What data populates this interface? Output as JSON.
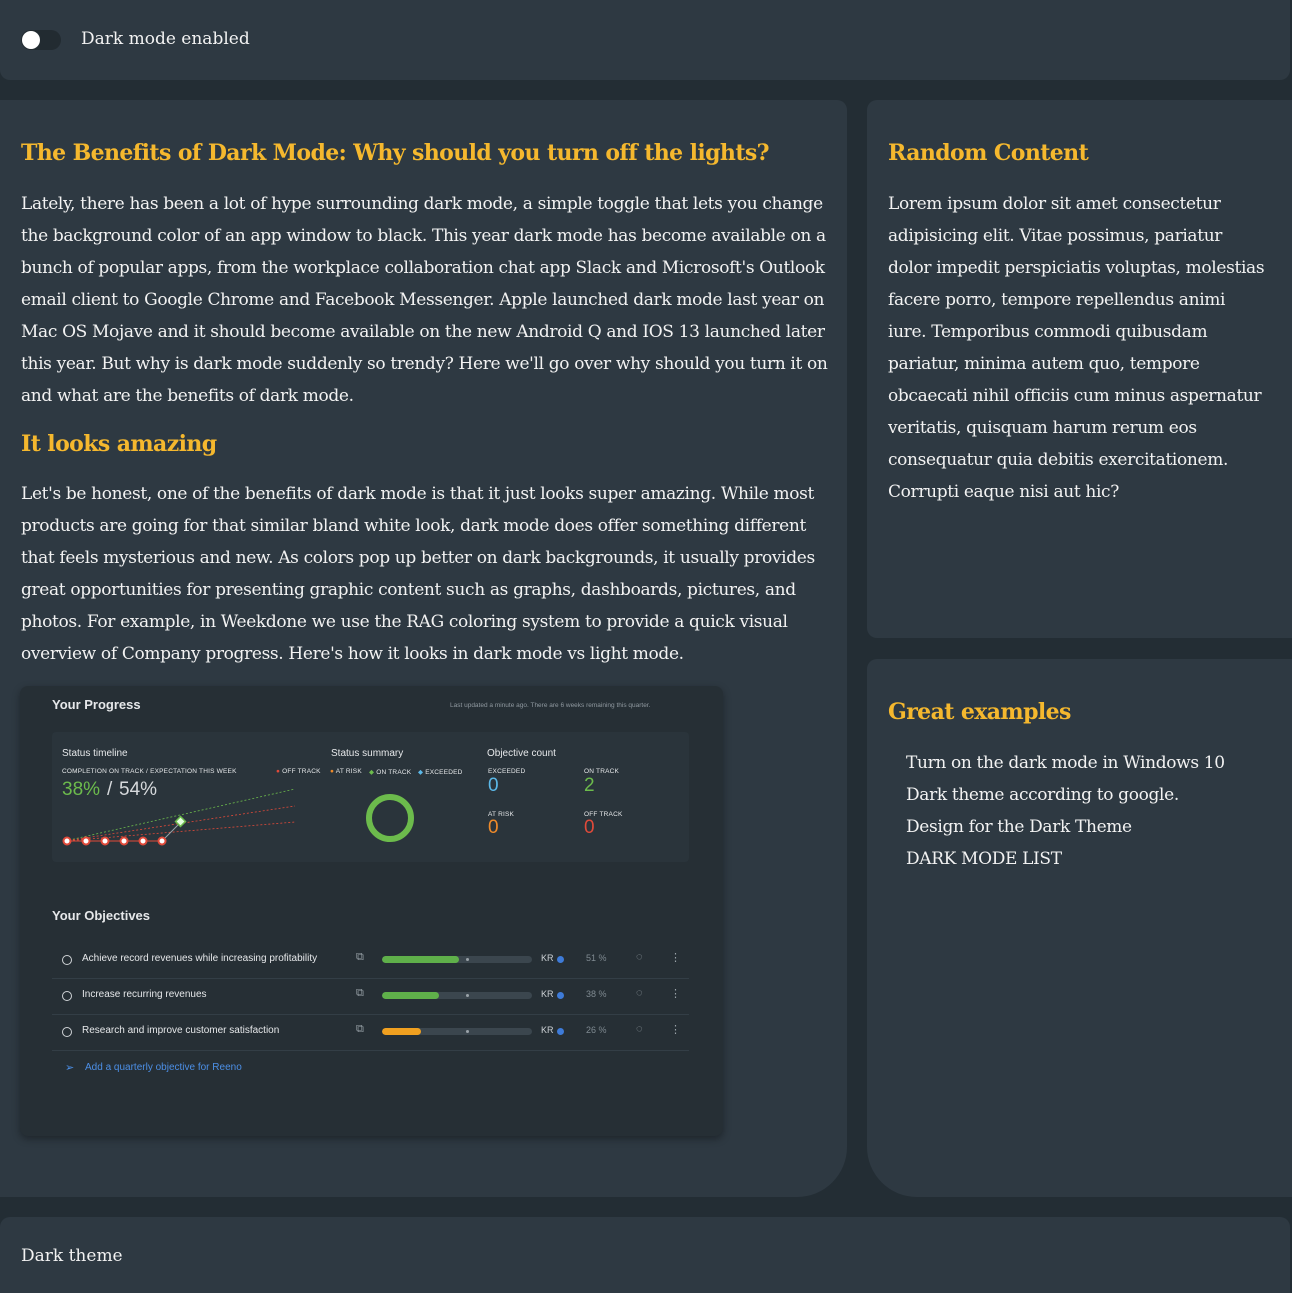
{
  "topbar": {
    "toggle_label": "Dark mode enabled",
    "toggle_on": false
  },
  "main": {
    "title": "The Benefits of Dark Mode: Why should you turn off the lights?",
    "intro": "Lately, there has been a lot of hype surrounding dark mode, a simple toggle that lets you change the background color of an app window to black. This year dark mode has become available on a bunch of popular apps, from the workplace collaboration chat app Slack and Microsoft's Outlook email client to Google Chrome and Facebook Messenger. Apple launched dark mode last year on Mac OS Mojave and it should become available on the new Android Q and IOS 13 launched later this year. But why is dark mode suddenly so trendy? Here we'll go over why should you turn it on and what are the benefits of dark mode.",
    "subtitle": "It looks amazing",
    "body": "Let's be honest, one of the benefits of dark mode is that it just looks super amazing. While most products are going for that similar bland white look, dark mode does offer something different that feels mysterious and new. As colors pop up better on dark backgrounds, it usually provides great opportunities for presenting graphic content such as graphs, dashboards, pictures, and photos. For example, in Weekdone we use the RAG coloring system to provide a quick visual overview of Company progress. Here's how it looks in dark mode vs light mode."
  },
  "dashboard": {
    "title": "Your Progress",
    "updated": "Last updated a minute ago. There are 6 weeks remaining this quarter.",
    "timeline_label": "Status timeline",
    "timeline_sub": "COMPLETION ON TRACK / EXPECTATION THIS WEEK",
    "completion": "38%",
    "slash": "/",
    "expectation": "54%",
    "summary_label": "Status summary",
    "legend": [
      "OFF TRACK",
      "AT RISK",
      "ON TRACK",
      "EXCEEDED"
    ],
    "count_label": "Objective count",
    "counts": [
      {
        "label": "EXCEEDED",
        "value": "0",
        "color": "#5bb8e8"
      },
      {
        "label": "ON TRACK",
        "value": "2",
        "color": "#6cbb4c"
      },
      {
        "label": "AT RISK",
        "value": "0",
        "color": "#ee8a2a"
      },
      {
        "label": "OFF TRACK",
        "value": "0",
        "color": "#e04a3a"
      }
    ],
    "objectives_title": "Your Objectives",
    "objectives": [
      {
        "name": "Achieve record revenues while increasing profitability",
        "kr": "KR",
        "pct": "51 %",
        "progress": 0.51,
        "color": "#5fb04a"
      },
      {
        "name": "Increase recurring revenues",
        "kr": "KR",
        "pct": "38 %",
        "progress": 0.38,
        "color": "#5fb04a"
      },
      {
        "name": "Research and improve customer satisfaction",
        "kr": "KR",
        "pct": "26 %",
        "progress": 0.26,
        "color": "#f0a020"
      }
    ],
    "add_label": "Add a quarterly objective for Reeno"
  },
  "side1": {
    "title": "Random Content",
    "text": "Lorem ipsum dolor sit amet consectetur adipisicing elit. Vitae possimus, pariatur dolor impedit perspiciatis voluptas, molestias facere porro, tempore repellendus animi iure. Temporibus commodi quibusdam pariatur, minima autem quo, tempore obcaecati nihil officiis cum minus aspernatur veritatis, quisquam harum rerum eos consequatur quia debitis exercitationem. Corrupti eaque nisi aut hic?"
  },
  "side2": {
    "title": "Great examples",
    "links": [
      "Turn on the dark mode in Windows 10",
      "Dark theme according to google.",
      "Design for the Dark Theme",
      "DARK MODE LIST"
    ]
  },
  "footer": {
    "text": "Dark theme"
  },
  "colors": {
    "accent": "#f5b82e",
    "panel": "#2e3942",
    "background": "#232d34"
  }
}
